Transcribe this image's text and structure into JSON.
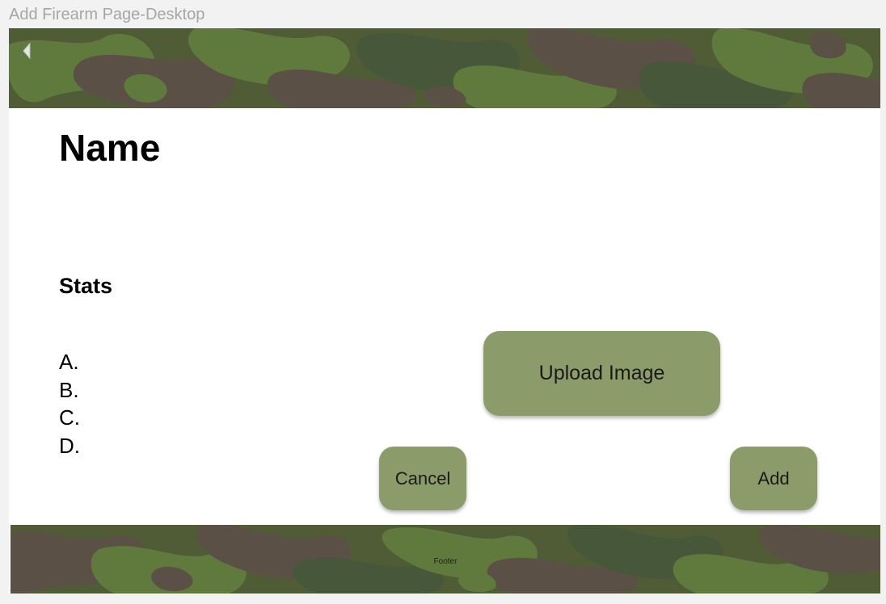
{
  "frame": {
    "label": "Add Firearm Page-Desktop"
  },
  "header": {
    "back_icon": "caret-left-icon"
  },
  "main": {
    "title": "Name",
    "stats_heading": "Stats",
    "stats_items": [
      "A.",
      "B.",
      "C.",
      "D."
    ],
    "upload_label": "Upload Image",
    "cancel_label": "Cancel",
    "add_label": "Add"
  },
  "footer": {
    "text": "Footer"
  },
  "colors": {
    "button": "#8c9b6a",
    "camo_base": "#4f5c36",
    "camo_green": "#5f7a3c",
    "camo_brown": "#5a5045",
    "camo_olive": "#47573a"
  }
}
